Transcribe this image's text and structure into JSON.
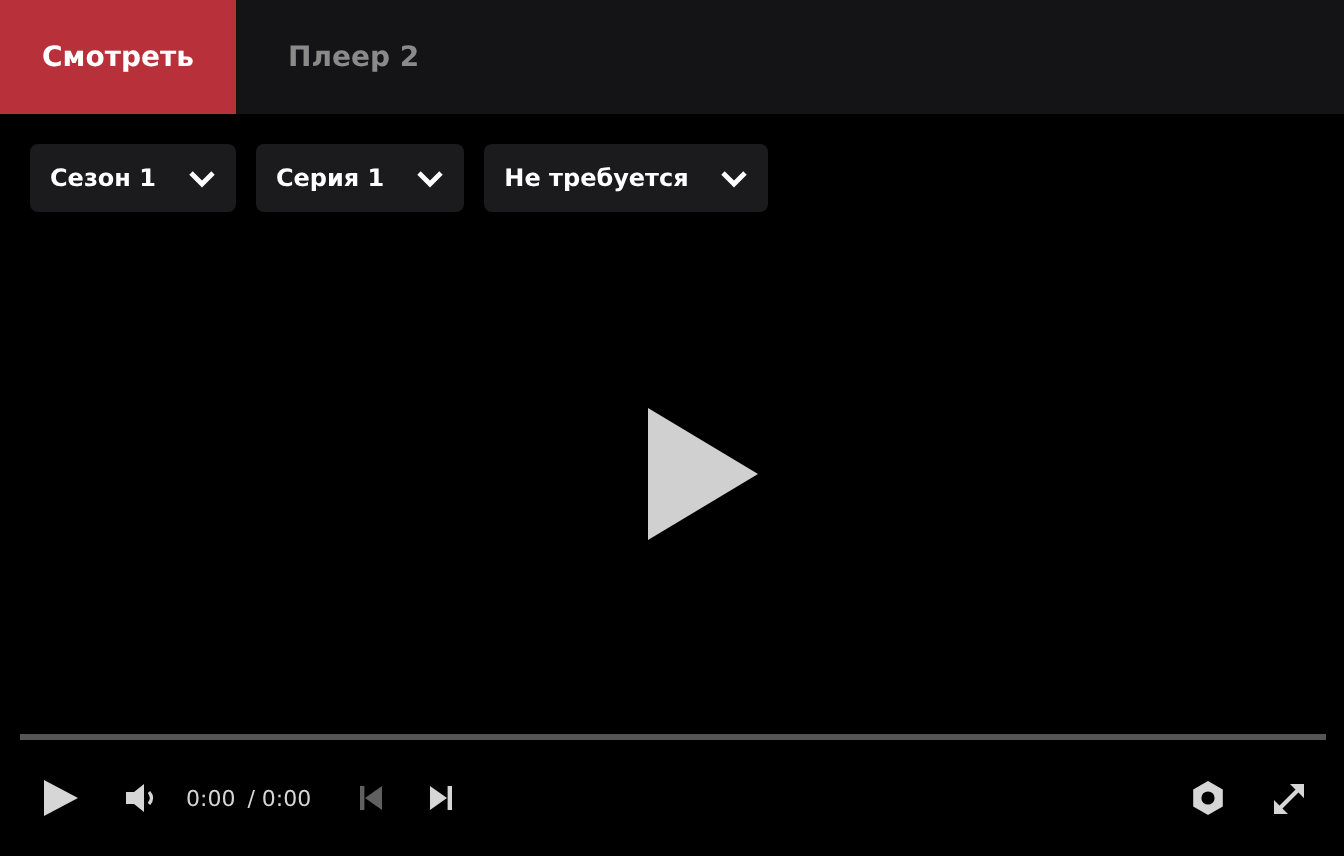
{
  "tabs": [
    {
      "label": "Смотреть",
      "selected": true
    },
    {
      "label": "Плеер 2",
      "selected": false
    }
  ],
  "selectors": [
    {
      "label": "Сезон 1"
    },
    {
      "label": "Серия 1"
    },
    {
      "label": "Не требуется"
    }
  ],
  "player": {
    "progress": {
      "level": 0
    },
    "time": "0:00",
    "duration": "/ 0:00",
    "prev_disabled": true,
    "next_disabled": false
  }
}
